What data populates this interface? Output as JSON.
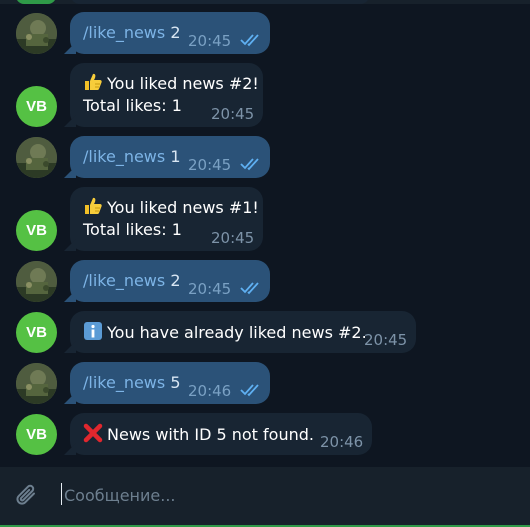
{
  "chat": {
    "messages": [
      {
        "type": "out",
        "command": "/like_news",
        "arg": "2",
        "time": "20:45"
      },
      {
        "type": "in",
        "avatar": "VB",
        "line1": "You liked news #2!",
        "line2": "Total likes: 1",
        "time": "20:45",
        "emoji": "thumbs-up"
      },
      {
        "type": "out",
        "command": "/like_news",
        "arg": "1",
        "time": "20:45"
      },
      {
        "type": "in",
        "avatar": "VB",
        "line1": "You liked news #1!",
        "line2": "Total likes: 1",
        "time": "20:45",
        "emoji": "thumbs-up"
      },
      {
        "type": "out",
        "command": "/like_news",
        "arg": "2",
        "time": "20:45"
      },
      {
        "type": "in",
        "avatar": "VB",
        "line1": "You have already liked news #2.",
        "time": "20:45",
        "emoji": "information"
      },
      {
        "type": "out",
        "command": "/like_news",
        "arg": "5",
        "time": "20:46"
      },
      {
        "type": "in",
        "avatar": "VB",
        "line1": "News with ID 5 not found.",
        "time": "20:46",
        "emoji": "cross-mark"
      }
    ]
  },
  "composer": {
    "placeholder": "Сообщение...",
    "attach_icon": "paperclip-icon"
  },
  "colors": {
    "background": "#0e1621",
    "outgoing_bubble": "#2b5278",
    "incoming_bubble": "#182533",
    "command_link": "#7db4e6",
    "bot_avatar": "#55c144",
    "read_ticks": "#5fb0f2"
  }
}
